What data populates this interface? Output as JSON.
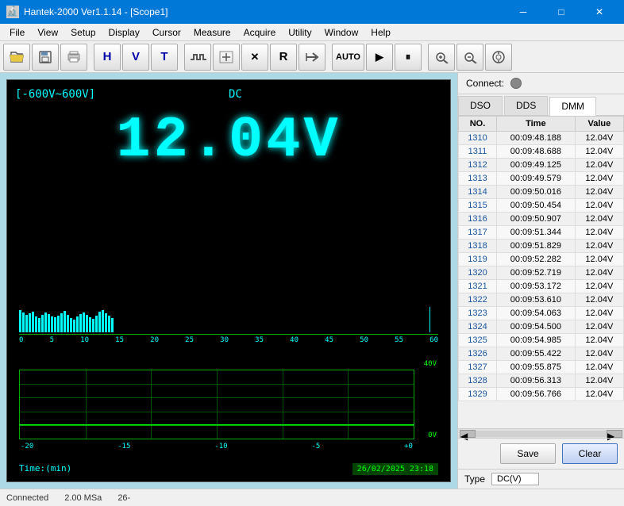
{
  "window": {
    "title": "Hantek-2000 Ver1.1.14 - [Scope1]",
    "icon": "oscilloscope-icon"
  },
  "title_bar": {
    "minimize_label": "─",
    "maximize_label": "□",
    "close_label": "✕"
  },
  "menu": {
    "items": [
      "File",
      "View",
      "Setup",
      "Display",
      "Cursor",
      "Measure",
      "Acquire",
      "Utility",
      "Window",
      "Help"
    ]
  },
  "toolbar": {
    "buttons": [
      {
        "label": "⬅",
        "name": "open-btn"
      },
      {
        "label": "💾",
        "name": "save-btn"
      },
      {
        "label": "🖨",
        "name": "print-btn"
      },
      {
        "label": "H",
        "name": "H-btn"
      },
      {
        "label": "V",
        "name": "V-btn"
      },
      {
        "label": "T",
        "name": "T-btn"
      },
      {
        "label": "⌐¬",
        "name": "ch1-btn"
      },
      {
        "label": "▦",
        "name": "math-btn"
      },
      {
        "label": "✕",
        "name": "cross-btn"
      },
      {
        "label": "R",
        "name": "ref-btn"
      },
      {
        "label": "↵",
        "name": "recall-btn"
      },
      {
        "label": "A",
        "name": "auto-btn"
      },
      {
        "label": "▶",
        "name": "run-btn"
      },
      {
        "label": "⏸",
        "name": "pause-btn"
      },
      {
        "label": "🔍+",
        "name": "zoom-in-btn"
      },
      {
        "label": "🔍-",
        "name": "zoom-out-btn"
      },
      {
        "label": "⊕",
        "name": "analyze-btn"
      }
    ]
  },
  "scope": {
    "range_label": "[-600V~600V]",
    "mode_label": "DC",
    "value_display": "12.04V",
    "histogram": {
      "scale": [
        "0",
        "5",
        "10",
        "15",
        "20",
        "25",
        "30",
        "35",
        "40",
        "45",
        "50",
        "55",
        "60"
      ]
    },
    "chart": {
      "y_max": "40V",
      "y_zero": "0V",
      "x_scale": [
        "-20",
        "-15",
        "-10",
        "-5",
        "+0"
      ]
    },
    "time_label": "Time:(min)",
    "datetime": "26/02/2025  23:18"
  },
  "right_panel": {
    "connect_label": "Connect:",
    "tabs": [
      "DSO",
      "DDS",
      "DMM"
    ],
    "active_tab": "DMM",
    "table": {
      "headers": [
        "NO.",
        "Time",
        "Value"
      ],
      "rows": [
        {
          "no": "1310",
          "time": "00:09:48.188",
          "value": "12.04V"
        },
        {
          "no": "1311",
          "time": "00:09:48.688",
          "value": "12.04V"
        },
        {
          "no": "1312",
          "time": "00:09:49.125",
          "value": "12.04V"
        },
        {
          "no": "1313",
          "time": "00:09:49.579",
          "value": "12.04V"
        },
        {
          "no": "1314",
          "time": "00:09:50.016",
          "value": "12.04V"
        },
        {
          "no": "1315",
          "time": "00:09:50.454",
          "value": "12.04V"
        },
        {
          "no": "1316",
          "time": "00:09:50.907",
          "value": "12.04V"
        },
        {
          "no": "1317",
          "time": "00:09:51.344",
          "value": "12.04V"
        },
        {
          "no": "1318",
          "time": "00:09:51.829",
          "value": "12.04V"
        },
        {
          "no": "1319",
          "time": "00:09:52.282",
          "value": "12.04V"
        },
        {
          "no": "1320",
          "time": "00:09:52.719",
          "value": "12.04V"
        },
        {
          "no": "1321",
          "time": "00:09:53.172",
          "value": "12.04V"
        },
        {
          "no": "1322",
          "time": "00:09:53.610",
          "value": "12.04V"
        },
        {
          "no": "1323",
          "time": "00:09:54.063",
          "value": "12.04V"
        },
        {
          "no": "1324",
          "time": "00:09:54.500",
          "value": "12.04V"
        },
        {
          "no": "1325",
          "time": "00:09:54.985",
          "value": "12.04V"
        },
        {
          "no": "1326",
          "time": "00:09:55.422",
          "value": "12.04V"
        },
        {
          "no": "1327",
          "time": "00:09:55.875",
          "value": "12.04V"
        },
        {
          "no": "1328",
          "time": "00:09:56.313",
          "value": "12.04V"
        },
        {
          "no": "1329",
          "time": "00:09:56.766",
          "value": "12.04V"
        }
      ]
    },
    "save_btn": "Save",
    "clear_btn": "Clear",
    "type_label": "Type",
    "type_value": "DC(V)"
  },
  "status_bar": {
    "connected_label": "Connected",
    "sample_rate": "2.00 MSa",
    "extra": "26-"
  }
}
